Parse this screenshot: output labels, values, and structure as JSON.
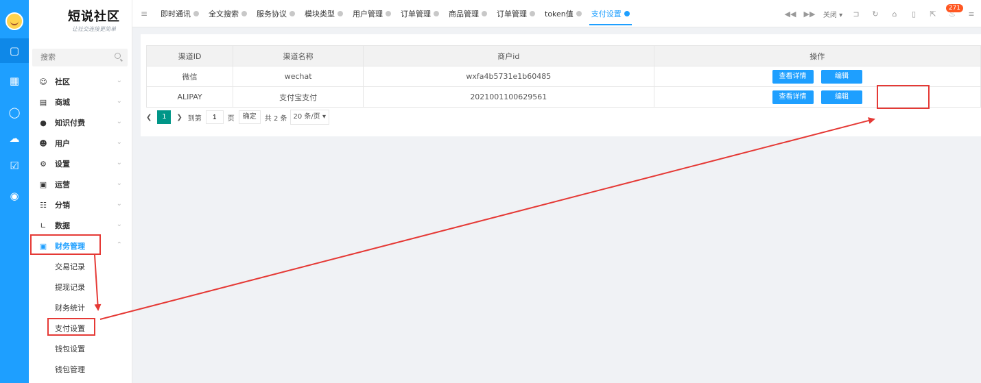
{
  "brand": {
    "title": "短说社区",
    "slogan": "让社交连接更简单"
  },
  "search": {
    "placeholder": "搜索"
  },
  "menu": [
    {
      "label": "社区",
      "icon": "chat-icon"
    },
    {
      "label": "商城",
      "icon": "shop-icon"
    },
    {
      "label": "知识付费",
      "icon": "bulb-icon"
    },
    {
      "label": "用户",
      "icon": "user-icon"
    },
    {
      "label": "设置",
      "icon": "gear-icon"
    },
    {
      "label": "运营",
      "icon": "monitor-icon"
    },
    {
      "label": "分销",
      "icon": "share-icon"
    },
    {
      "label": "数据",
      "icon": "chart-icon"
    },
    {
      "label": "财务管理",
      "icon": "wallet-icon"
    }
  ],
  "finance_sub": [
    "交易记录",
    "提现记录",
    "财务统计",
    "支付设置",
    "钱包设置",
    "钱包管理"
  ],
  "tabs": [
    "即时通讯",
    "全文搜索",
    "服务协议",
    "模块类型",
    "用户管理",
    "订单管理",
    "商品管理",
    "订单管理",
    "token值",
    "支付设置"
  ],
  "tools": {
    "close": "关闭",
    "badge": "271"
  },
  "table": {
    "headers": [
      "渠道ID",
      "渠道名称",
      "商户id",
      "操作"
    ],
    "rows": [
      {
        "id": "微信",
        "name": "wechat",
        "merchant": "wxfa4b5731e1b60485"
      },
      {
        "id": "ALIPAY",
        "name": "支付宝支付",
        "merchant": "2021001100629561"
      }
    ],
    "view_label": "查看详情",
    "edit_label": "编辑"
  },
  "pager": {
    "current": "1",
    "goto": "到第",
    "page_input": "1",
    "page_unit": "页",
    "confirm": "确定",
    "total": "共 2 条",
    "per_page": "20 条/页"
  },
  "colors": {
    "accent": "#1e9fff",
    "highlight": "#e53935",
    "pager": "#009688"
  }
}
